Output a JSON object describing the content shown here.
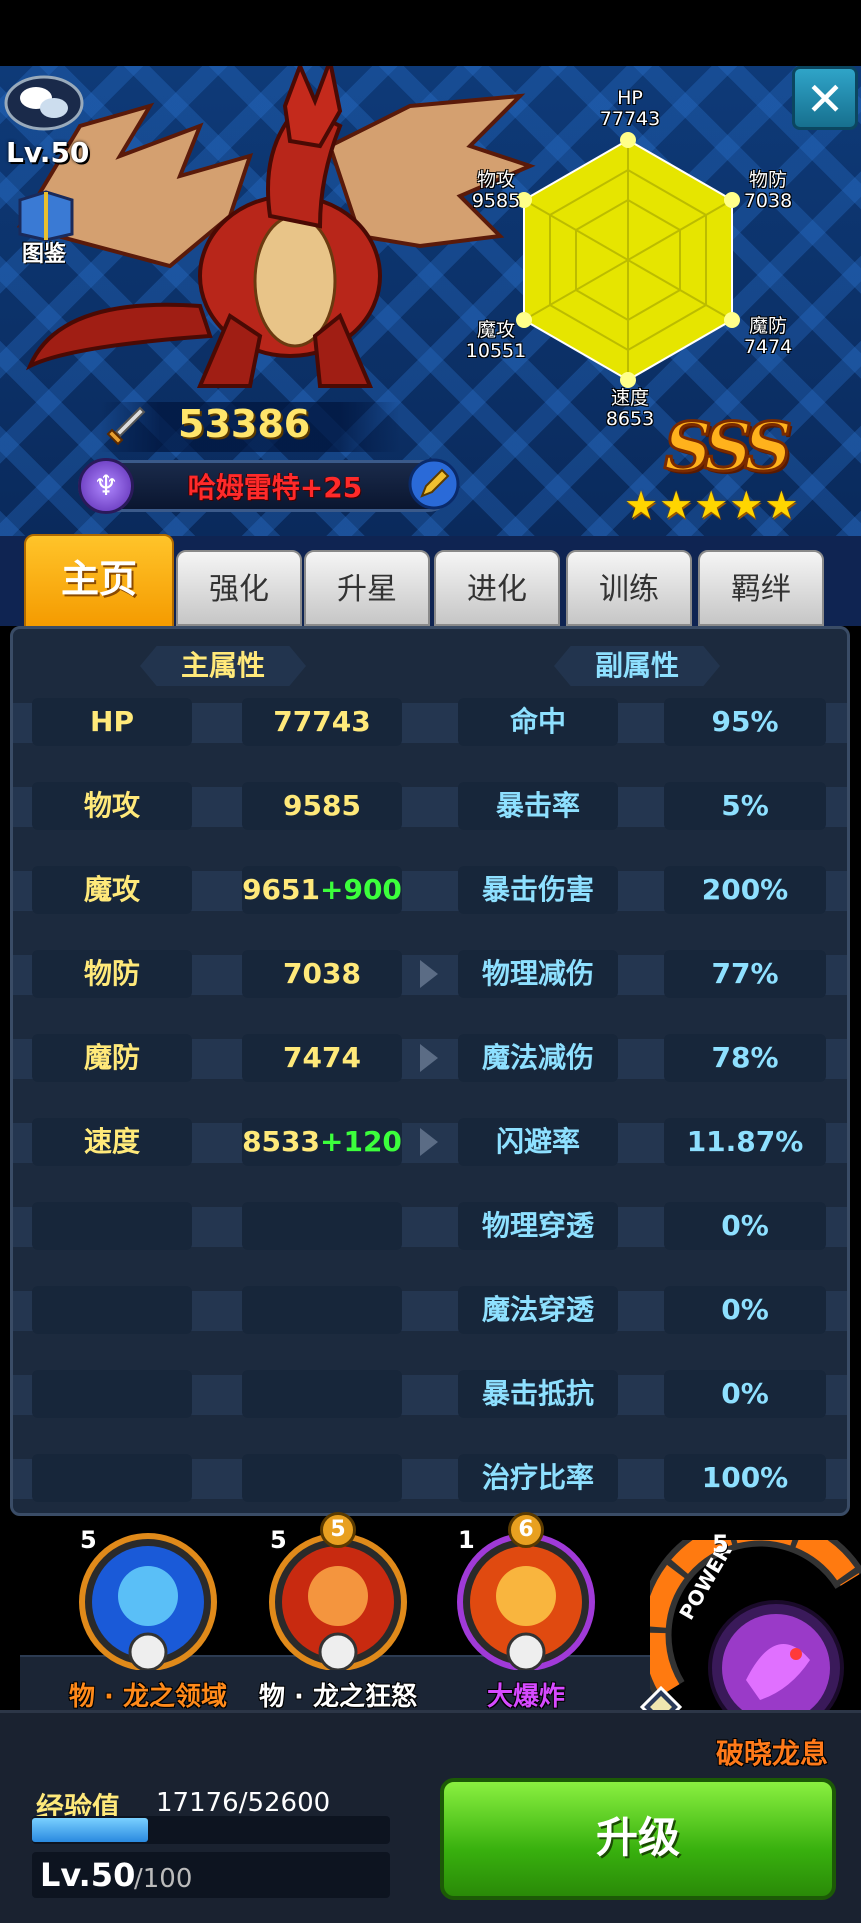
{
  "hero": {
    "level_prefix": "Lv.",
    "level": "50",
    "atlas_label": "图鉴",
    "power": "53386",
    "name": "哈姆雷特+25",
    "rank": "SSS",
    "stars": 5
  },
  "radar": {
    "hp": {
      "label": "HP",
      "value": "77743"
    },
    "pdef": {
      "label": "物防",
      "value": "7038"
    },
    "mdef": {
      "label": "魔防",
      "value": "7474"
    },
    "spd": {
      "label": "速度",
      "value": "8653"
    },
    "matk": {
      "label": "魔攻",
      "value": "10551"
    },
    "patk": {
      "label": "物攻",
      "value": "9585"
    }
  },
  "tabs": [
    "主页",
    "强化",
    "升星",
    "进化",
    "训练",
    "羁绊"
  ],
  "stats": {
    "main_header": "主属性",
    "sub_header": "副属性",
    "rows": [
      {
        "name": "HP",
        "value": "77743",
        "bonus": "",
        "sub_name": "命中",
        "sub_value": "95%"
      },
      {
        "name": "物攻",
        "value": "9585",
        "bonus": "",
        "sub_name": "暴击率",
        "sub_value": "5%"
      },
      {
        "name": "魔攻",
        "value": "9651",
        "bonus": "+900",
        "sub_name": "暴击伤害",
        "sub_value": "200%"
      },
      {
        "name": "物防",
        "value": "7038",
        "bonus": "",
        "sub_name": "物理减伤",
        "sub_value": "77%"
      },
      {
        "name": "魔防",
        "value": "7474",
        "bonus": "",
        "sub_name": "魔法减伤",
        "sub_value": "78%"
      },
      {
        "name": "速度",
        "value": "8533",
        "bonus": "+120",
        "sub_name": "闪避率",
        "sub_value": "11.87%"
      },
      {
        "name": "",
        "value": "",
        "bonus": "",
        "sub_name": "物理穿透",
        "sub_value": "0%"
      },
      {
        "name": "",
        "value": "",
        "bonus": "",
        "sub_name": "魔法穿透",
        "sub_value": "0%"
      },
      {
        "name": "",
        "value": "",
        "bonus": "",
        "sub_name": "暴击抵抗",
        "sub_value": "0%"
      },
      {
        "name": "",
        "value": "",
        "bonus": "",
        "sub_name": "治疗比率",
        "sub_value": "100%"
      }
    ]
  },
  "skills": [
    {
      "name": "物 · 龙之领域",
      "level": "5",
      "rank": "",
      "color": "#ff8a1a",
      "element": "blue"
    },
    {
      "name": "物 · 龙之狂怒",
      "level": "5",
      "rank": "5",
      "color": "#ffffff",
      "element": "red"
    },
    {
      "name": "大爆炸",
      "level": "1",
      "rank": "6",
      "color": "#d64aff",
      "element": "fire"
    }
  ],
  "ultimate": {
    "name": "破晓龙息",
    "level": "5",
    "power_label": "POWER"
  },
  "exp": {
    "label": "经验值",
    "value": "17176/52600",
    "fraction": 0.3265
  },
  "level_bar": {
    "current": "Lv.50",
    "max": "/100"
  },
  "upgrade_label": "升级",
  "close_symbol": "✕"
}
